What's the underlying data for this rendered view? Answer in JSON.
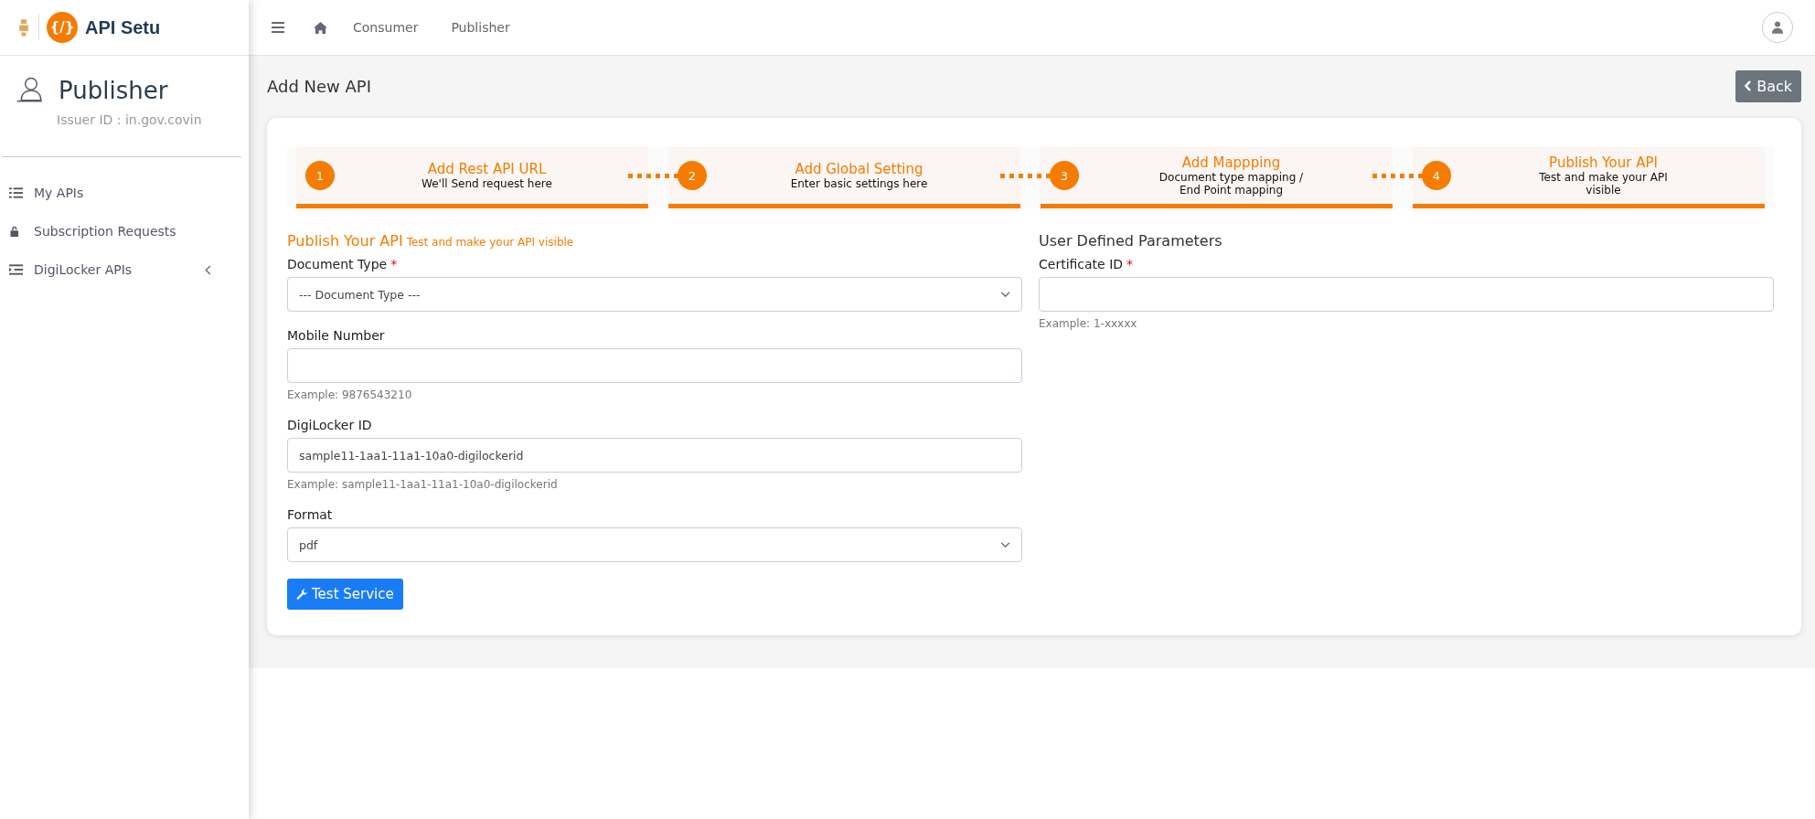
{
  "brand": {
    "name": "API Setu",
    "logo_text": "{/}"
  },
  "topbar": {
    "links": [
      "Consumer",
      "Publisher"
    ]
  },
  "profile": {
    "title": "Publisher",
    "issuer": "Issuer ID : in.gov.covin"
  },
  "sidebar": {
    "items": [
      {
        "label": "My APIs",
        "kind": "list",
        "has_submenu": false
      },
      {
        "label": "Subscription Requests",
        "kind": "lock",
        "has_submenu": false
      },
      {
        "label": "DigiLocker APIs",
        "kind": "indent",
        "has_submenu": true
      }
    ]
  },
  "page": {
    "title": "Add New API",
    "back_button": "Back"
  },
  "steps": [
    {
      "number": "1",
      "title": "Add Rest API URL",
      "subtitle": "We'll Send request here"
    },
    {
      "number": "2",
      "title": "Add Global Setting",
      "subtitle": "Enter basic settings here"
    },
    {
      "number": "3",
      "title": "Add Mappping",
      "subtitle": "Document type mapping / End Point mapping"
    },
    {
      "number": "4",
      "title": "Publish Your API",
      "subtitle": "Test and make your API visible"
    }
  ],
  "left_form": {
    "heading": "Publish Your API",
    "heading_note": "Test and make your API visible",
    "fields": [
      {
        "label": "Document Type",
        "required_mark": "*",
        "kind": "select",
        "value": "--- Document Type ---"
      },
      {
        "label": "Mobile Number",
        "kind": "input",
        "hint": "Example: 9876543210"
      },
      {
        "label": "DigiLocker ID",
        "kind": "input",
        "value": "sample11-1aa1-11a1-10a0-digilockerid",
        "hint": "Example: sample11-1aa1-11a1-10a0-digilockerid"
      },
      {
        "label": "Format",
        "kind": "select",
        "value": "pdf"
      }
    ],
    "button": "Test Service"
  },
  "right_form": {
    "heading": "User Defined Parameters",
    "fields": [
      {
        "label": "Certificate ID",
        "required_mark": "*",
        "kind": "input",
        "hint": "Example: 1-xxxxx"
      }
    ]
  }
}
